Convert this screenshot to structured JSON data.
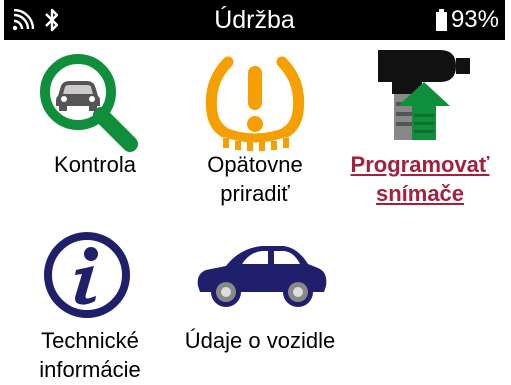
{
  "status_bar": {
    "title": "Údržba",
    "battery_percent": "93%",
    "icons": [
      "wifi-icon",
      "bluetooth-icon",
      "battery-icon"
    ]
  },
  "tiles": [
    {
      "label_line1": "Kontrola",
      "label_line2": "",
      "icon": "magnifier-car-icon",
      "active": false
    },
    {
      "label_line1": "Opätovne",
      "label_line2": "priradiť",
      "icon": "tpms-warning-icon",
      "active": false
    },
    {
      "label_line1": "Programovať",
      "label_line2": "snímače",
      "icon": "sensor-program-icon",
      "active": true
    },
    {
      "label_line1": "Technické",
      "label_line2": "informácie",
      "icon": "info-icon",
      "active": false
    },
    {
      "label_line1": "Údaje o vozidle",
      "label_line2": "",
      "icon": "car-icon",
      "active": false
    }
  ],
  "colors": {
    "green": "#0f8f3c",
    "amber": "#f5a000",
    "navy": "#1f1f6b",
    "active_label": "#a3213c"
  }
}
